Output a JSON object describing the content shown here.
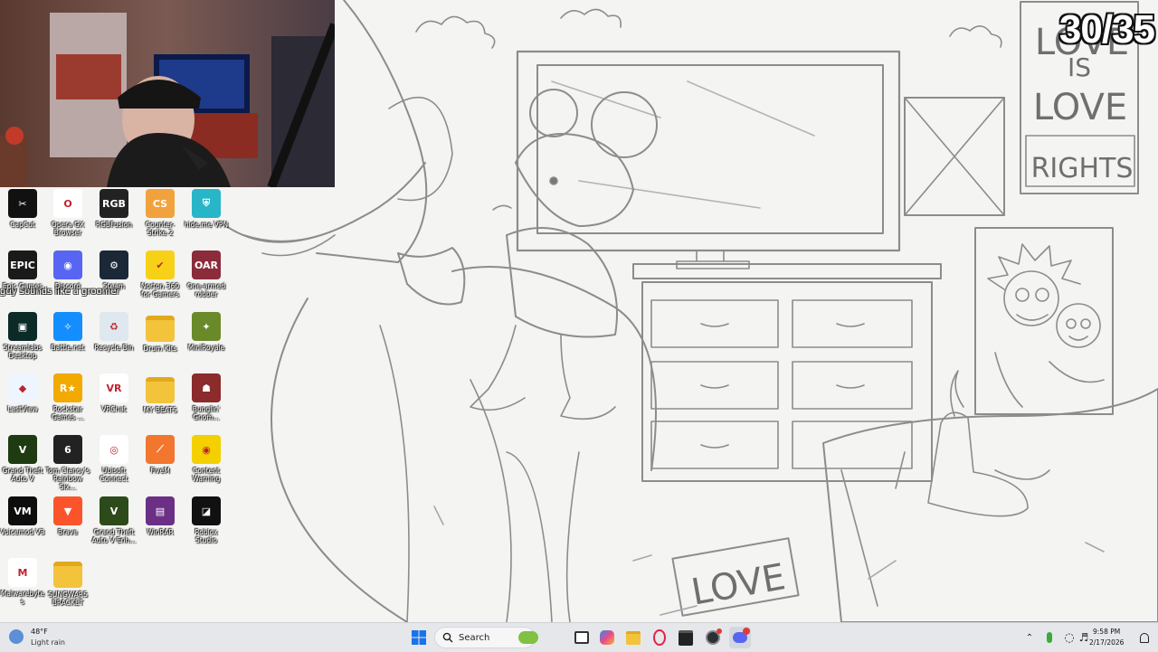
{
  "overlay": {
    "counter": "30/35",
    "chat_message": "guy sounds like a groomer"
  },
  "wallpaper": {
    "poster_text_1": "LOVE",
    "poster_text_2": "IS",
    "poster_text_3": "LOVE",
    "poster_text_4": "RIGHTS",
    "sign_text": "LOVE"
  },
  "desktop_icons": [
    {
      "label": "CapCut",
      "icon": "capcut-icon",
      "color": "#111111"
    },
    {
      "label": "Opera GX Browser",
      "icon": "opera-gx-icon",
      "color": "#ffffff"
    },
    {
      "label": "RGBFusion",
      "icon": "rgb-fusion-icon",
      "color": "#222222"
    },
    {
      "label": "Counter-Strike 2",
      "icon": "counter-strike-icon",
      "color": "#f2a23c"
    },
    {
      "label": "hide.me VPN",
      "icon": "hide-me-vpn-icon",
      "color": "#28b5c8"
    },
    {
      "label": "Epic Games",
      "icon": "epic-games-icon",
      "color": "#1a1a1a"
    },
    {
      "label": "Discord",
      "icon": "discord-icon",
      "color": "#5865f2"
    },
    {
      "label": "Steam",
      "icon": "steam-icon",
      "color": "#1b2838"
    },
    {
      "label": "Norton 360 for Gamers",
      "icon": "norton-icon",
      "color": "#f7d117"
    },
    {
      "label": "One-armed robber",
      "icon": "one-armed-robber-icon",
      "color": "#8a2c3a"
    },
    {
      "label": "Streamlabs Desktop",
      "icon": "streamlabs-icon",
      "color": "#0c2b26"
    },
    {
      "label": "Battle.net",
      "icon": "battlenet-icon",
      "color": "#148eff"
    },
    {
      "label": "Recycle Bin",
      "icon": "recycle-bin-icon",
      "color": "#dfe8ee"
    },
    {
      "label": "Drum Kits",
      "icon": "folder-icon",
      "color": "#f3c33c"
    },
    {
      "label": "MiniRoyale",
      "icon": "mini-royale-icon",
      "color": "#6a8a2a"
    },
    {
      "label": "LastView",
      "icon": "lastview-icon",
      "color": "#eef5ff"
    },
    {
      "label": "Rockstar Games ...",
      "icon": "rockstar-icon",
      "color": "#f2a900"
    },
    {
      "label": "VRChat",
      "icon": "vrchat-icon",
      "color": "#ffffff"
    },
    {
      "label": "MY BEATS",
      "icon": "folder-icon",
      "color": "#f3c33c"
    },
    {
      "label": "Bunglin' Gnom...",
      "icon": "bunglin-gnome-icon",
      "color": "#8b2b2b"
    },
    {
      "label": "Grand Theft Auto V",
      "icon": "gta-v-icon",
      "color": "#1f3b12"
    },
    {
      "label": "Tom Clancy's Rainbow Six...",
      "icon": "rainbow-six-icon",
      "color": "#222222"
    },
    {
      "label": "Ubisoft Connect",
      "icon": "ubisoft-icon",
      "color": "#ffffff"
    },
    {
      "label": "FiveM",
      "icon": "fivem-icon",
      "color": "#f2762e"
    },
    {
      "label": "Content Warning",
      "icon": "content-warning-icon",
      "color": "#f5d000"
    },
    {
      "label": "Voicemod V3",
      "icon": "voicemod-icon",
      "color": "#0d0d0d"
    },
    {
      "label": "Brave",
      "icon": "brave-icon",
      "color": "#fb542b"
    },
    {
      "label": "Grand Theft Auto V Enh...",
      "icon": "gta-v-enhanced-icon",
      "color": "#2d4a1a"
    },
    {
      "label": "WinRAR",
      "icon": "winrar-icon",
      "color": "#6b2f86"
    },
    {
      "label": "Roblox Studio",
      "icon": "roblox-studio-icon",
      "color": "#111111"
    },
    {
      "label": "Malwarebytes",
      "icon": "malwarebytes-icon",
      "color": "#ffffff"
    },
    {
      "label": "SUNGWARS BRACKET",
      "icon": "folder-icon",
      "color": "#f3c33c"
    }
  ],
  "taskbar": {
    "weather_temp": "48°F",
    "weather_desc": "Light rain",
    "search_label": "Search",
    "time": "9:58 PM",
    "date": "2/17/2026"
  }
}
